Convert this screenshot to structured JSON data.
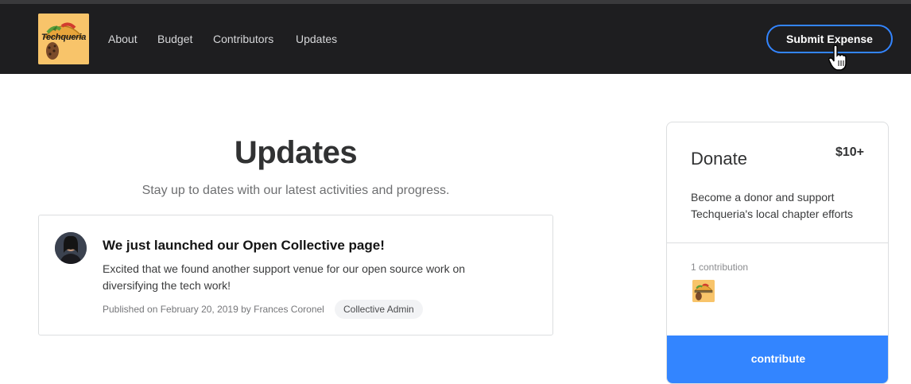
{
  "header": {
    "logo_text": "Techqueria",
    "nav": [
      {
        "label": "About"
      },
      {
        "label": "Budget"
      },
      {
        "label": "Contributors"
      },
      {
        "label": "Updates"
      }
    ],
    "submit_expense_label": "Submit Expense"
  },
  "main": {
    "title": "Updates",
    "subtitle": "Stay up to dates with our latest activities and progress.",
    "update": {
      "title": "We just launched our Open Collective page!",
      "body": "Excited that we found another support venue for our open source work on diversifying the tech work!",
      "meta": "Published on February 20, 2019 by Frances Coronel",
      "role_badge": "Collective Admin"
    }
  },
  "donate": {
    "title": "Donate",
    "amount": "$10+",
    "description": "Become a donor and support Techqueria's local chapter efforts",
    "contributions_count": "1 contribution",
    "contribute_label": "contribute"
  },
  "colors": {
    "nav_bg": "#1e1e20",
    "accent": "#3385ff",
    "logo_bg": "#f8c46a"
  }
}
